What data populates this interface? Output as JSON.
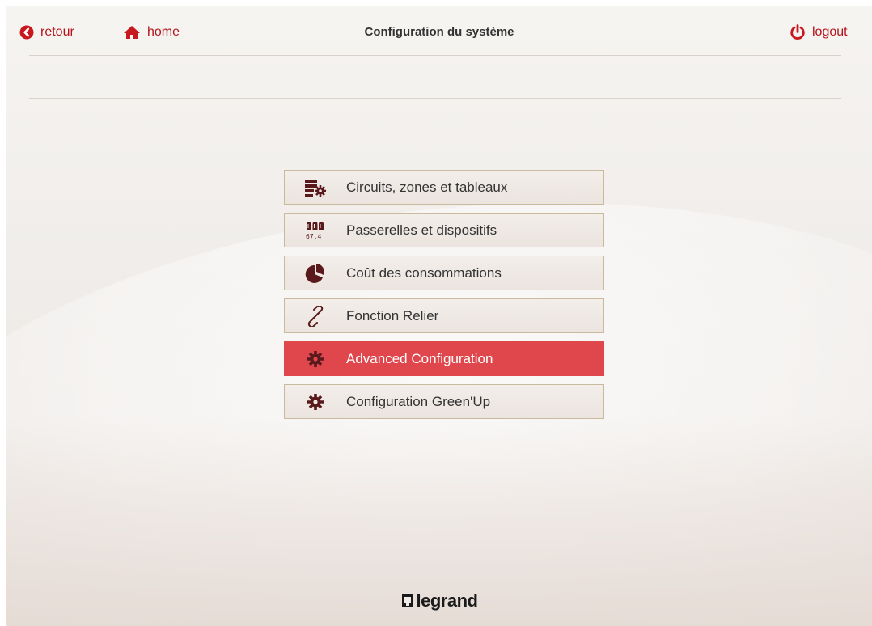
{
  "header": {
    "back_label": "retour",
    "home_label": "home",
    "title": "Configuration du système",
    "logout_label": "logout"
  },
  "menu": {
    "items": [
      {
        "label": "Circuits, zones et tableaux",
        "icon": "circuits-gear-icon"
      },
      {
        "label": "Passerelles et dispositifs",
        "icon": "meter-devices-icon"
      },
      {
        "label": "Coût des consommations",
        "icon": "pie-chart-icon"
      },
      {
        "label": "Fonction Relier",
        "icon": "link-icon"
      },
      {
        "label": "Advanced Configuration",
        "icon": "gear-icon",
        "active": true
      },
      {
        "label": "Configuration Green'Up",
        "icon": "gear-icon"
      }
    ]
  },
  "footer": {
    "brand": "legrand"
  },
  "colors": {
    "accent": "#b3141c",
    "active_bg": "#e0474d",
    "icon": "#5a1a1d"
  }
}
